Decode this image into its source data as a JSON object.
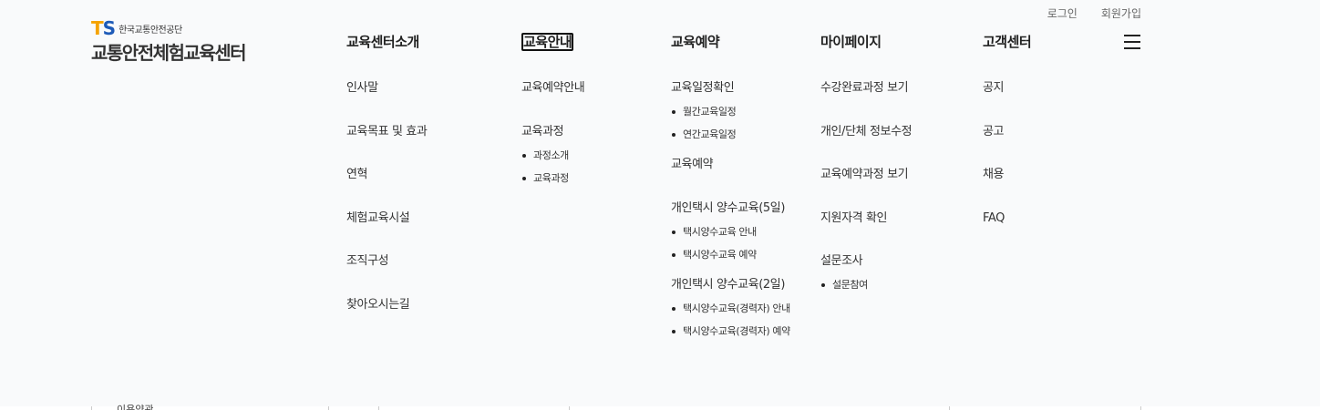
{
  "util": {
    "login": "로그인",
    "signup": "회원가입"
  },
  "logo": {
    "mark_t": "T",
    "mark_s": "S",
    "org": "한국교통안전공단",
    "title": "교통안전체험교육센터"
  },
  "nav": [
    {
      "title": "교육센터소개",
      "groups": [
        {
          "label": "인사말",
          "subs": []
        },
        {
          "label": "교육목표 및 효과",
          "subs": []
        },
        {
          "label": "연혁",
          "subs": []
        },
        {
          "label": "체험교육시설",
          "subs": []
        },
        {
          "label": "조직구성",
          "subs": []
        },
        {
          "label": "찾아오시는길",
          "subs": []
        }
      ]
    },
    {
      "title": "교육안내",
      "groups": [
        {
          "label": "교육예약안내",
          "subs": []
        },
        {
          "label": "교육과정",
          "subs": [
            "과정소개",
            "교육과정"
          ]
        }
      ]
    },
    {
      "title": "교육예약",
      "groups": [
        {
          "label": "교육일정확인",
          "subs": [
            "월간교육일정",
            "연간교육일정"
          ]
        },
        {
          "label": "교육예약",
          "subs": []
        },
        {
          "label": "개인택시 양수교육(5일)",
          "subs": [
            "택시양수교육 안내",
            "택시양수교육 예약"
          ]
        },
        {
          "label": "개인택시 양수교육(2일)",
          "subs": [
            "택시양수교육(경력자) 안내",
            "택시양수교육(경력자) 예약"
          ]
        }
      ]
    },
    {
      "title": "마이페이지",
      "groups": [
        {
          "label": "수강완료과정 보기",
          "subs": []
        },
        {
          "label": "개인/단체 정보수정",
          "subs": []
        },
        {
          "label": "교육예약과정 보기",
          "subs": []
        },
        {
          "label": "지원자격 확인",
          "subs": []
        },
        {
          "label": "설문조사",
          "subs": [
            "설문참여"
          ]
        }
      ]
    },
    {
      "title": "고객센터",
      "groups": [
        {
          "label": "공지",
          "subs": []
        },
        {
          "label": "공고",
          "subs": []
        },
        {
          "label": "채용",
          "subs": []
        },
        {
          "label": "FAQ",
          "subs": []
        }
      ]
    }
  ],
  "active_index": 1,
  "footer": {
    "partial_text": "이용약관"
  },
  "colors": {
    "ts_orange": "#f5a300",
    "ts_blue": "#1e5bb8"
  }
}
